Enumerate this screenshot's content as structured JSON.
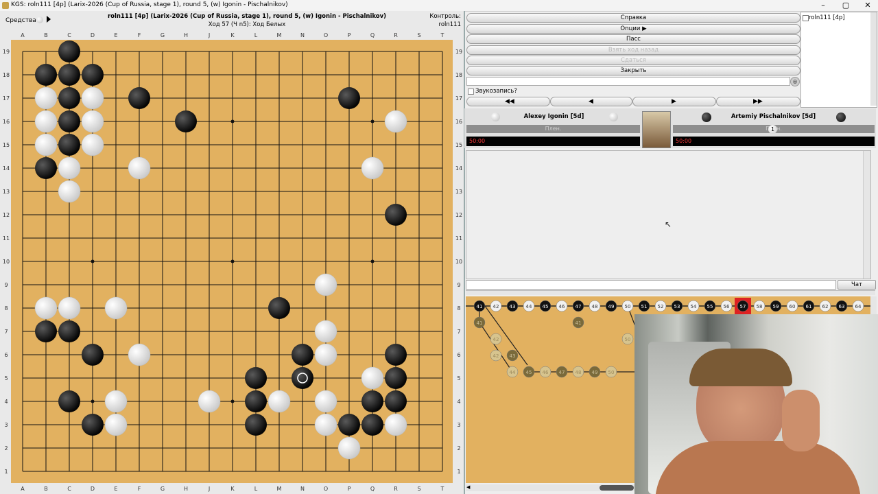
{
  "titlebar": {
    "title": "KGS: roln111 [4p] (Larix-2026 (Cup of Russia, stage 1), round 5, (w) Igonin - Pischalnikov)"
  },
  "board_header": {
    "tools_label": "Средства",
    "game_title": "roln111 [4p] (Larix-2026 (Cup of Russia, stage 1), round 5, (w) Igonin - Pischalnikov)",
    "move_info": "Ход 57 (Ч n5): Ход Белых",
    "control_label": "Контроль:",
    "control_user": "roln111"
  },
  "board": {
    "columns": [
      "A",
      "B",
      "C",
      "D",
      "E",
      "F",
      "G",
      "H",
      "J",
      "K",
      "L",
      "M",
      "N",
      "O",
      "P",
      "Q",
      "R",
      "S",
      "T"
    ],
    "rows": [
      "19",
      "18",
      "17",
      "16",
      "15",
      "14",
      "13",
      "12",
      "11",
      "10",
      "9",
      "8",
      "7",
      "6",
      "5",
      "4",
      "3",
      "2",
      "1"
    ],
    "black_stones": [
      "C19",
      "B18",
      "C18",
      "D18",
      "C17",
      "F17",
      "P17",
      "C16",
      "H16",
      "C15",
      "B14",
      "R12",
      "M8",
      "B7",
      "C7",
      "D6",
      "N6",
      "R6",
      "L5",
      "N5",
      "R5",
      "C4",
      "L4",
      "Q4",
      "R4",
      "D3",
      "L3",
      "P3",
      "Q3"
    ],
    "white_stones": [
      "B17",
      "D17",
      "B16",
      "D16",
      "R16",
      "B15",
      "D15",
      "C14",
      "F14",
      "Q14",
      "C13",
      "O9",
      "B8",
      "C8",
      "E8",
      "O7",
      "F6",
      "O6",
      "Q5",
      "E4",
      "J4",
      "M4",
      "O4",
      "E3",
      "O3",
      "R3",
      "P2"
    ],
    "last_move": "N5"
  },
  "menu": {
    "help": "Справка",
    "options": "Опции",
    "pass": "Пасс",
    "undo": "Взять ход назад",
    "resign": "Сдаться",
    "close": "Закрыть",
    "sound_record": "Звукозапись?"
  },
  "user_list": [
    "roln111 [4p]"
  ],
  "players": {
    "white": {
      "name": "Alexey Igonin [5d]",
      "status": "Плен.",
      "time": "50:00"
    },
    "black": {
      "name": "Artemiy Pischalnikov [5d]",
      "status": "Плен.",
      "captures": "1",
      "time": "50:00"
    }
  },
  "chat": {
    "room_chat_button": "Чат комнаты"
  },
  "tree": {
    "main_line": [
      "41",
      "42",
      "43",
      "44",
      "45",
      "46",
      "47",
      "48",
      "49",
      "50",
      "51",
      "52",
      "53",
      "54",
      "55",
      "56",
      "57",
      "58",
      "59",
      "60",
      "61",
      "62",
      "63",
      "64"
    ],
    "current_move": "57",
    "branch_a": [
      "42",
      "43"
    ],
    "branch_b": [
      "44",
      "45",
      "46",
      "47",
      "48",
      "49",
      "50"
    ],
    "branch_single": [
      "41"
    ],
    "branch_c": [
      "50"
    ]
  },
  "colors": {
    "board": "#e2b160",
    "last_move_highlight": "#dd2222",
    "clock_text": "#ff3a3a"
  }
}
